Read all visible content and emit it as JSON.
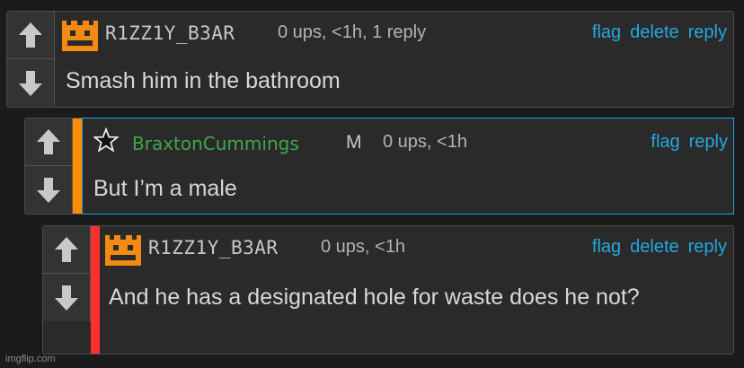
{
  "comments": [
    {
      "username": "R1ZZ1Y_B3AR",
      "meta": "0 ups, <1h, 1 reply",
      "actions": [
        "flag",
        "delete",
        "reply"
      ],
      "text": "Smash him in the bathroom",
      "avatar": "orange-pixel-face-icon"
    },
    {
      "username": "BraxtonCummings",
      "badge": "M",
      "meta": "0 ups, <1h",
      "actions": [
        "flag",
        "reply"
      ],
      "text": "But I’m a male",
      "avatar": "star-icon",
      "bar_color": "#ff8c00",
      "border_color": "#1e9fd8"
    },
    {
      "username": "R1ZZ1Y_B3AR",
      "meta": "0 ups, <1h",
      "actions": [
        "flag",
        "delete",
        "reply"
      ],
      "text": "And he has a designated hole for waste does he not?",
      "avatar": "orange-pixel-face-icon",
      "bar_color": "#ff3030"
    }
  ],
  "watermark": "imgflip.com",
  "colors": {
    "link": "#25a8e0",
    "username_green": "#3ea84a",
    "avatar_orange": "#f28a14"
  }
}
